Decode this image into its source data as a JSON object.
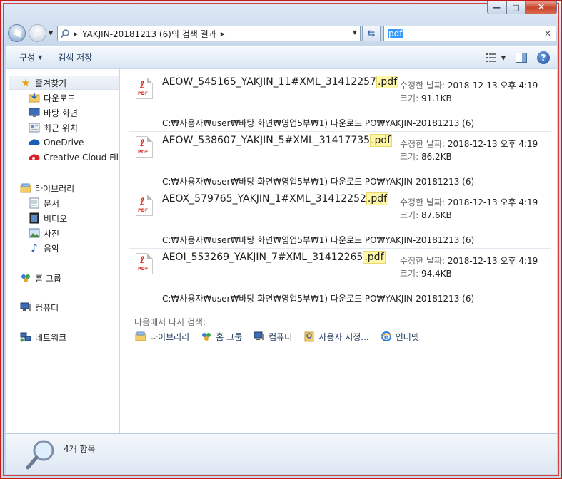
{
  "window": {
    "caption_min": "—",
    "caption_max": "□",
    "caption_close": "✕"
  },
  "address": {
    "segments": [
      "YAKJIN-20181213 (6)의 검색 결과"
    ]
  },
  "search": {
    "value": "pdf"
  },
  "toolbar": {
    "organize": "구성",
    "save_search": "검색 저장"
  },
  "sidebar": {
    "favorites": "즐겨찾기",
    "favorite_items": [
      {
        "label": "다운로드",
        "icon": "downloads-folder-icon"
      },
      {
        "label": "바탕 화면",
        "icon": "desktop-icon"
      },
      {
        "label": "최근 위치",
        "icon": "recent-places-icon"
      },
      {
        "label": "OneDrive",
        "icon": "onedrive-icon"
      },
      {
        "label": "Creative Cloud Files",
        "icon": "creative-cloud-icon"
      }
    ],
    "libraries": "라이브러리",
    "library_items": [
      {
        "label": "문서",
        "icon": "documents-icon"
      },
      {
        "label": "비디오",
        "icon": "videos-icon"
      },
      {
        "label": "사진",
        "icon": "pictures-icon"
      },
      {
        "label": "음악",
        "icon": "music-icon"
      }
    ],
    "homegroup": "홈 그룹",
    "computer": "컴퓨터",
    "network": "네트워크"
  },
  "results": [
    {
      "name_prefix": "AEOW_545165_YAKJIN_11#XML_31412257",
      "name_match": ".pdf",
      "date_label": "수정한 날짜:",
      "date": "2018-12-13 오후 4:19",
      "size_label": "크기:",
      "size": "91.1KB",
      "path": "C:₩사용자₩user₩바탕 화면₩영업5부₩1) 다운로드 PO₩YAKJIN-20181213 (6)"
    },
    {
      "name_prefix": "AEOW_538607_YAKJIN_5#XML_31417735",
      "name_match": ".pdf",
      "date_label": "수정한 날짜:",
      "date": "2018-12-13 오후 4:19",
      "size_label": "크기:",
      "size": "86.2KB",
      "path": "C:₩사용자₩user₩바탕 화면₩영업5부₩1) 다운로드 PO₩YAKJIN-20181213 (6)"
    },
    {
      "name_prefix": "AEOX_579765_YAKJIN_1#XML_31412252",
      "name_match": ".pdf",
      "date_label": "수정한 날짜:",
      "date": "2018-12-13 오후 4:19",
      "size_label": "크기:",
      "size": "87.6KB",
      "path": "C:₩사용자₩user₩바탕 화면₩영업5부₩1) 다운로드 PO₩YAKJIN-20181213 (6)"
    },
    {
      "name_prefix": "AEOI_553269_YAKJIN_7#XML_31412265",
      "name_match": ".pdf",
      "date_label": "수정한 날짜:",
      "date": "2018-12-13 오후 4:19",
      "size_label": "크기:",
      "size": "94.4KB",
      "path": "C:₩사용자₩user₩바탕 화면₩영업5부₩1) 다운로드 PO₩YAKJIN-20181213 (6)"
    }
  ],
  "search_again": {
    "label": "다음에서 다시 검색:",
    "items": [
      {
        "label": "라이브러리",
        "icon": "libraries-icon"
      },
      {
        "label": "홈 그룹",
        "icon": "homegroup-icon"
      },
      {
        "label": "컴퓨터",
        "icon": "computer-icon"
      },
      {
        "label": "사용자 지정...",
        "icon": "custom-folder-icon"
      },
      {
        "label": "인터넷",
        "icon": "internet-icon"
      }
    ]
  },
  "details": {
    "count": "4개 항목"
  },
  "colors": {
    "frame": "#c81a1a",
    "highlight": "#fff7a6",
    "selection": "#3399ff",
    "pdf_red": "#d6261e"
  }
}
